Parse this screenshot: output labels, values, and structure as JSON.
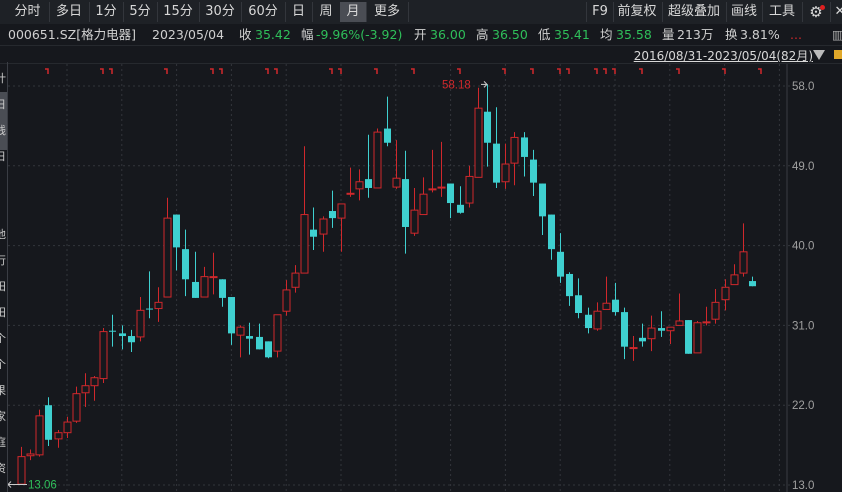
{
  "tabs": [
    "分时",
    "多日",
    "1分",
    "5分",
    "15分",
    "30分",
    "60分",
    "日",
    "周",
    "月",
    "更多"
  ],
  "active_tab": "月",
  "toolbar_right": [
    "F9",
    "前复权",
    "超级叠加",
    "画线",
    "工具"
  ],
  "info": {
    "code": "000651.SZ[格力电器]",
    "date": "2023/05/04",
    "close_label": "收",
    "close": "35.42",
    "change_label": "幅",
    "change": "-9.96%(-3.92)",
    "open_label": "开",
    "open": "36.00",
    "high_label": "高",
    "high": "36.50",
    "low_label": "低",
    "low": "35.41",
    "avg_label": "均",
    "avg": "35.58",
    "vol_label": "量",
    "vol": "213万",
    "turnover_label": "换",
    "turnover": "3.81%",
    "more": "..."
  },
  "range": "2016/08/31-2023/05/04(82月)",
  "left_strip": [
    "计",
    "日",
    "线",
    "日",
    "、",
    "-",
    "他",
    "行",
    "田",
    "田",
    "个",
    "个",
    "果",
    "家",
    "庭",
    "资"
  ],
  "colors": {
    "up": "#d0282c",
    "down": "#3fd0d0",
    "bg": "#16181d",
    "grid": "#3a3d44"
  },
  "chart_data": {
    "type": "candlestick",
    "title": "000651.SZ 格力电器 月线",
    "period": "monthly",
    "y_ticks": [
      "58.0",
      "49.0",
      "40.0",
      "31.0",
      "22.0",
      "13.0"
    ],
    "ylim": [
      13.0,
      58.0
    ],
    "max_label": "58.18",
    "min_label": "13.06",
    "max_index": 51,
    "min_index": 0,
    "event_markers": [
      3,
      9,
      10,
      16,
      21,
      22,
      27,
      28,
      34,
      35,
      39,
      43,
      48,
      53,
      56,
      59,
      60,
      63,
      64,
      65,
      68,
      72,
      77,
      81
    ],
    "candles": [
      [
        13.1,
        17.3,
        13.06,
        16.2
      ],
      [
        16.3,
        17.0,
        15.8,
        16.5
      ],
      [
        16.4,
        21.5,
        16.2,
        20.8
      ],
      [
        22.0,
        22.9,
        17.4,
        18.1
      ],
      [
        18.2,
        19.2,
        17.2,
        18.9
      ],
      [
        18.9,
        20.7,
        18.3,
        20.1
      ],
      [
        20.2,
        24.1,
        20.0,
        23.3
      ],
      [
        23.4,
        25.6,
        21.8,
        24.2
      ],
      [
        24.2,
        25.3,
        22.5,
        25.1
      ],
      [
        25.0,
        30.7,
        24.5,
        30.3
      ],
      [
        30.4,
        32.2,
        28.6,
        30.3
      ],
      [
        30.1,
        31.0,
        28.3,
        29.8
      ],
      [
        29.8,
        30.5,
        28.0,
        29.1
      ],
      [
        29.7,
        34.2,
        29.2,
        32.7
      ],
      [
        32.9,
        37.1,
        31.8,
        32.8
      ],
      [
        32.9,
        35.3,
        31.4,
        33.6
      ],
      [
        34.2,
        45.4,
        34.2,
        43.1
      ],
      [
        43.5,
        43.5,
        37.2,
        39.8
      ],
      [
        39.6,
        41.8,
        34.3,
        36.2
      ],
      [
        35.9,
        39.3,
        34.1,
        34.1
      ],
      [
        34.2,
        37.6,
        34.2,
        36.5
      ],
      [
        36.5,
        39.2,
        34.5,
        36.5
      ],
      [
        36.2,
        36.2,
        33.1,
        34.1
      ],
      [
        34.2,
        34.2,
        28.8,
        30.1
      ],
      [
        29.9,
        31.0,
        27.4,
        30.8
      ],
      [
        29.8,
        31.3,
        27.7,
        29.5
      ],
      [
        29.7,
        31.2,
        28.3,
        28.3
      ],
      [
        29.2,
        29.2,
        27.3,
        27.4
      ],
      [
        28.1,
        32.2,
        27.4,
        32.2
      ],
      [
        32.6,
        36.1,
        32.1,
        35.0
      ],
      [
        35.3,
        37.8,
        34.7,
        36.9
      ],
      [
        36.9,
        51.2,
        36.9,
        43.5
      ],
      [
        41.8,
        44.3,
        39.5,
        41.0
      ],
      [
        41.3,
        43.3,
        39.3,
        43.0
      ],
      [
        43.9,
        46.2,
        42.0,
        43.1
      ],
      [
        43.1,
        44.7,
        39.3,
        44.7
      ],
      [
        45.8,
        48.8,
        45.5,
        45.9
      ],
      [
        46.4,
        48.6,
        45.1,
        47.2
      ],
      [
        47.5,
        52.5,
        45.4,
        46.5
      ],
      [
        46.5,
        53.2,
        46.5,
        52.8
      ],
      [
        53.2,
        56.8,
        51.2,
        51.6
      ],
      [
        46.6,
        51.9,
        46.4,
        47.6
      ],
      [
        47.5,
        50.7,
        39.1,
        42.1
      ],
      [
        41.4,
        46.5,
        41.1,
        44.0
      ],
      [
        43.5,
        47.7,
        43.5,
        45.8
      ],
      [
        46.3,
        50.8,
        46.0,
        46.4
      ],
      [
        46.5,
        51.7,
        45.5,
        46.6
      ],
      [
        47.0,
        47.0,
        43.1,
        44.8
      ],
      [
        44.6,
        46.7,
        43.6,
        43.7
      ],
      [
        44.8,
        49.0,
        44.3,
        47.8
      ],
      [
        47.7,
        57.8,
        47.7,
        55.5
      ],
      [
        55.1,
        58.18,
        48.9,
        51.6
      ],
      [
        51.5,
        55.6,
        46.5,
        47.1
      ],
      [
        47.2,
        51.5,
        46.4,
        49.2
      ],
      [
        49.3,
        52.8,
        46.8,
        52.2
      ],
      [
        52.2,
        52.8,
        47.8,
        50.0
      ],
      [
        49.7,
        50.8,
        45.6,
        47.1
      ],
      [
        47.0,
        47.0,
        41.2,
        43.3
      ],
      [
        43.5,
        43.5,
        38.4,
        39.6
      ],
      [
        39.3,
        41.4,
        35.8,
        36.5
      ],
      [
        36.8,
        37.0,
        33.2,
        34.3
      ],
      [
        34.4,
        36.3,
        31.8,
        32.4
      ],
      [
        32.2,
        33.0,
        30.1,
        30.7
      ],
      [
        30.6,
        33.6,
        30.4,
        32.6
      ],
      [
        32.8,
        36.5,
        32.8,
        33.5
      ],
      [
        33.9,
        35.8,
        32.1,
        32.5
      ],
      [
        32.5,
        33.0,
        27.2,
        28.6
      ],
      [
        28.4,
        29.8,
        27.0,
        28.5
      ],
      [
        29.6,
        31.2,
        28.6,
        29.2
      ],
      [
        29.5,
        32.1,
        28.1,
        30.7
      ],
      [
        30.7,
        32.6,
        29.7,
        30.4
      ],
      [
        30.4,
        30.8,
        28.9,
        30.8
      ],
      [
        31.0,
        34.6,
        31.0,
        31.5
      ],
      [
        31.6,
        31.6,
        27.8,
        27.8
      ],
      [
        27.9,
        31.5,
        27.9,
        31.3
      ],
      [
        31.4,
        33.1,
        31.0,
        31.4
      ],
      [
        31.7,
        35.1,
        31.2,
        33.6
      ],
      [
        33.9,
        36.2,
        32.7,
        35.3
      ],
      [
        35.6,
        37.9,
        35.6,
        36.7
      ],
      [
        36.9,
        42.5,
        36.5,
        39.3
      ],
      [
        36.0,
        36.5,
        35.41,
        35.42
      ]
    ]
  }
}
